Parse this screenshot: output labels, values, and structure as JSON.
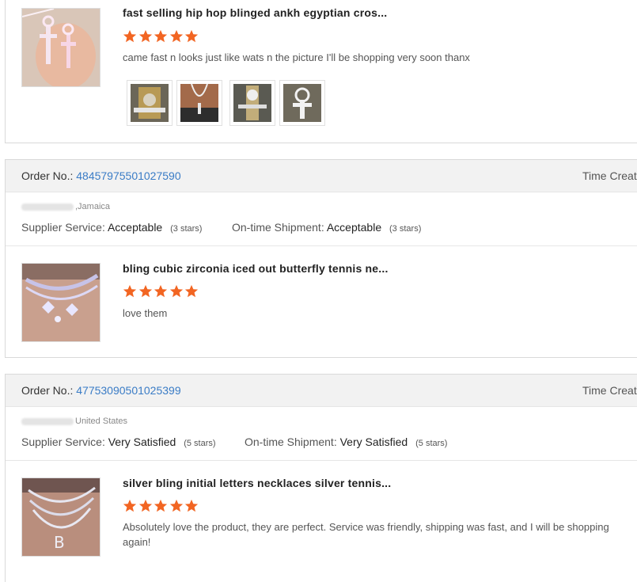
{
  "reviews": [
    {
      "product_title": "fast selling hip hop blinged ankh egyptian cros...",
      "stars": 5,
      "review_text": "came fast n looks just like wats n the picture I'll be shopping very soon thanx",
      "gallery_count": 4
    },
    {
      "order_label": "Order No.:",
      "order_number": "48457975501027590",
      "time_label": "Time Create",
      "location": ",Jamaica",
      "supplier_service_label": "Supplier Service:",
      "supplier_service_value": "Acceptable",
      "supplier_service_stars": "(3 stars)",
      "shipment_label": "On-time Shipment:",
      "shipment_value": "Acceptable",
      "shipment_stars": "(3 stars)",
      "product_title": "bling cubic zirconia iced out butterfly tennis ne...",
      "stars": 5,
      "review_text": "love them"
    },
    {
      "order_label": "Order No.:",
      "order_number": "47753090501025399",
      "time_label": "Time Create",
      "location": "United States",
      "supplier_service_label": "Supplier Service:",
      "supplier_service_value": "Very Satisfied",
      "supplier_service_stars": "(5 stars)",
      "shipment_label": "On-time Shipment:",
      "shipment_value": "Very Satisfied",
      "shipment_stars": "(5 stars)",
      "product_title": "silver bling initial letters necklaces silver tennis...",
      "stars": 5,
      "review_text": "Absolutely love the product, they are perfect. Service was friendly, shipping was fast, and I will be shopping again!"
    }
  ],
  "colors": {
    "star": "#f26522",
    "order_link": "#3a7cc6",
    "header_bg": "#f2f2f2"
  },
  "icons": {
    "star": "star-icon"
  }
}
